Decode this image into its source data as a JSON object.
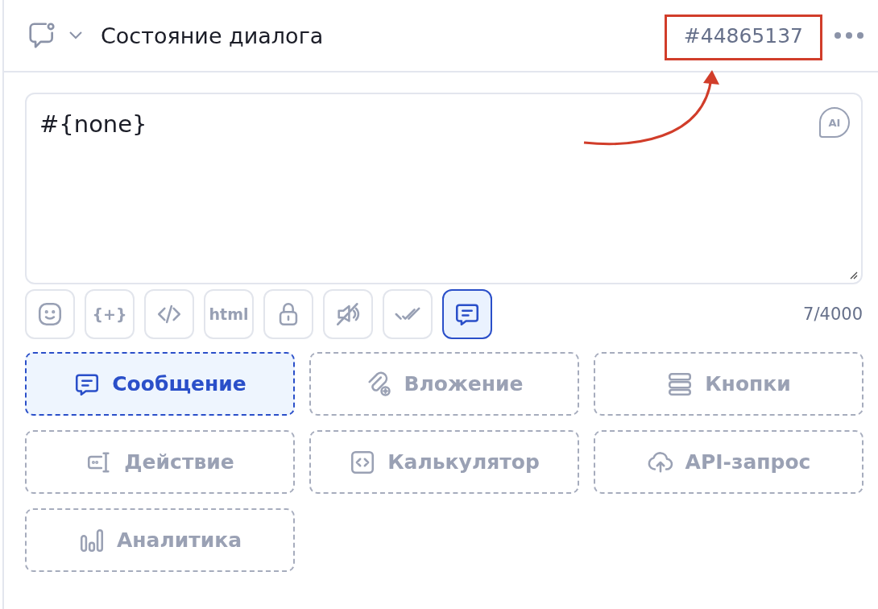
{
  "header": {
    "title": "Состояние диалога",
    "dialog_id": "#44865137",
    "id_highlighted": true
  },
  "editor": {
    "value": "#{none}",
    "ai_label": "AI",
    "counter": "7/4000"
  },
  "toolbar": [
    {
      "kind": "emoji",
      "selected": false
    },
    {
      "kind": "variable",
      "label": "{+}",
      "selected": false
    },
    {
      "kind": "code",
      "selected": false
    },
    {
      "kind": "html",
      "label": "html",
      "selected": false
    },
    {
      "kind": "lock",
      "selected": false
    },
    {
      "kind": "mute",
      "selected": false
    },
    {
      "kind": "read",
      "selected": false
    },
    {
      "kind": "message",
      "selected": true
    }
  ],
  "blocks": [
    {
      "kind": "message",
      "label": "Сообщение",
      "selected": true
    },
    {
      "kind": "attachment",
      "label": "Вложение",
      "selected": false
    },
    {
      "kind": "buttons",
      "label": "Кнопки",
      "selected": false
    },
    {
      "kind": "action",
      "label": "Действие",
      "selected": false
    },
    {
      "kind": "calculator",
      "label": "Калькулятор",
      "selected": false
    },
    {
      "kind": "api",
      "label": "API-запрос",
      "selected": false
    },
    {
      "kind": "analytics",
      "label": "Аналитика",
      "selected": false
    }
  ]
}
